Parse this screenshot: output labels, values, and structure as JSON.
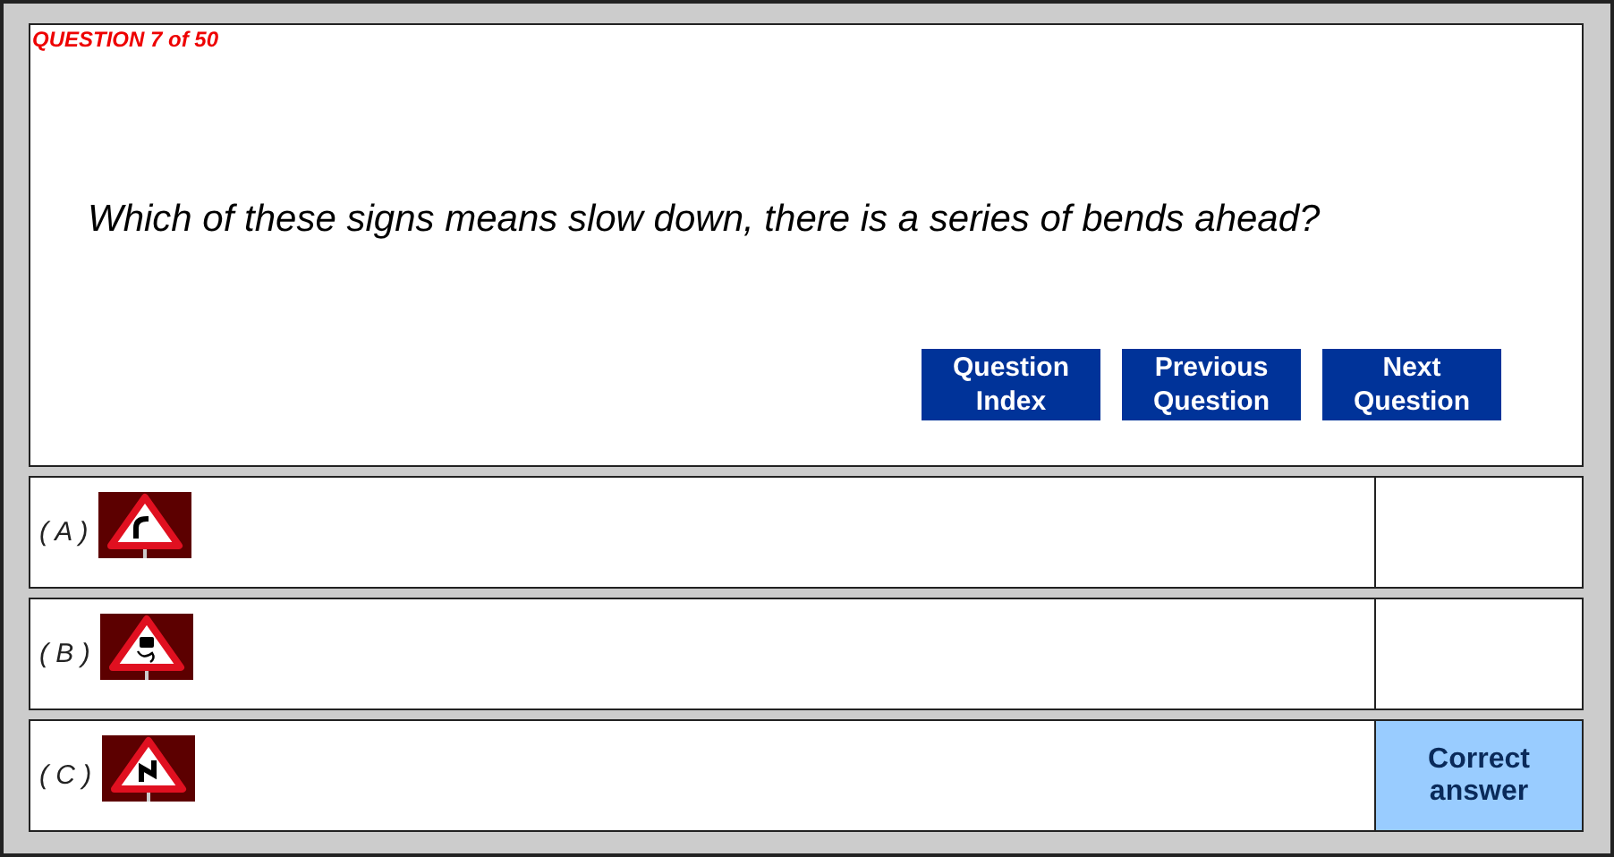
{
  "progress": "QUESTION 7 of 50",
  "question": "Which of these signs means slow down, there is a series of bends ahead?",
  "buttons": [
    {
      "label": "Question Index"
    },
    {
      "label": "Previous Question"
    },
    {
      "label": "Next Question"
    }
  ],
  "options": [
    {
      "label": "( A )",
      "kind": "bend",
      "correct": false
    },
    {
      "label": "( B )",
      "kind": "slippery",
      "correct": false
    },
    {
      "label": "( C )",
      "kind": "double-bend",
      "correct": true,
      "feedback": "Correct answer"
    }
  ]
}
